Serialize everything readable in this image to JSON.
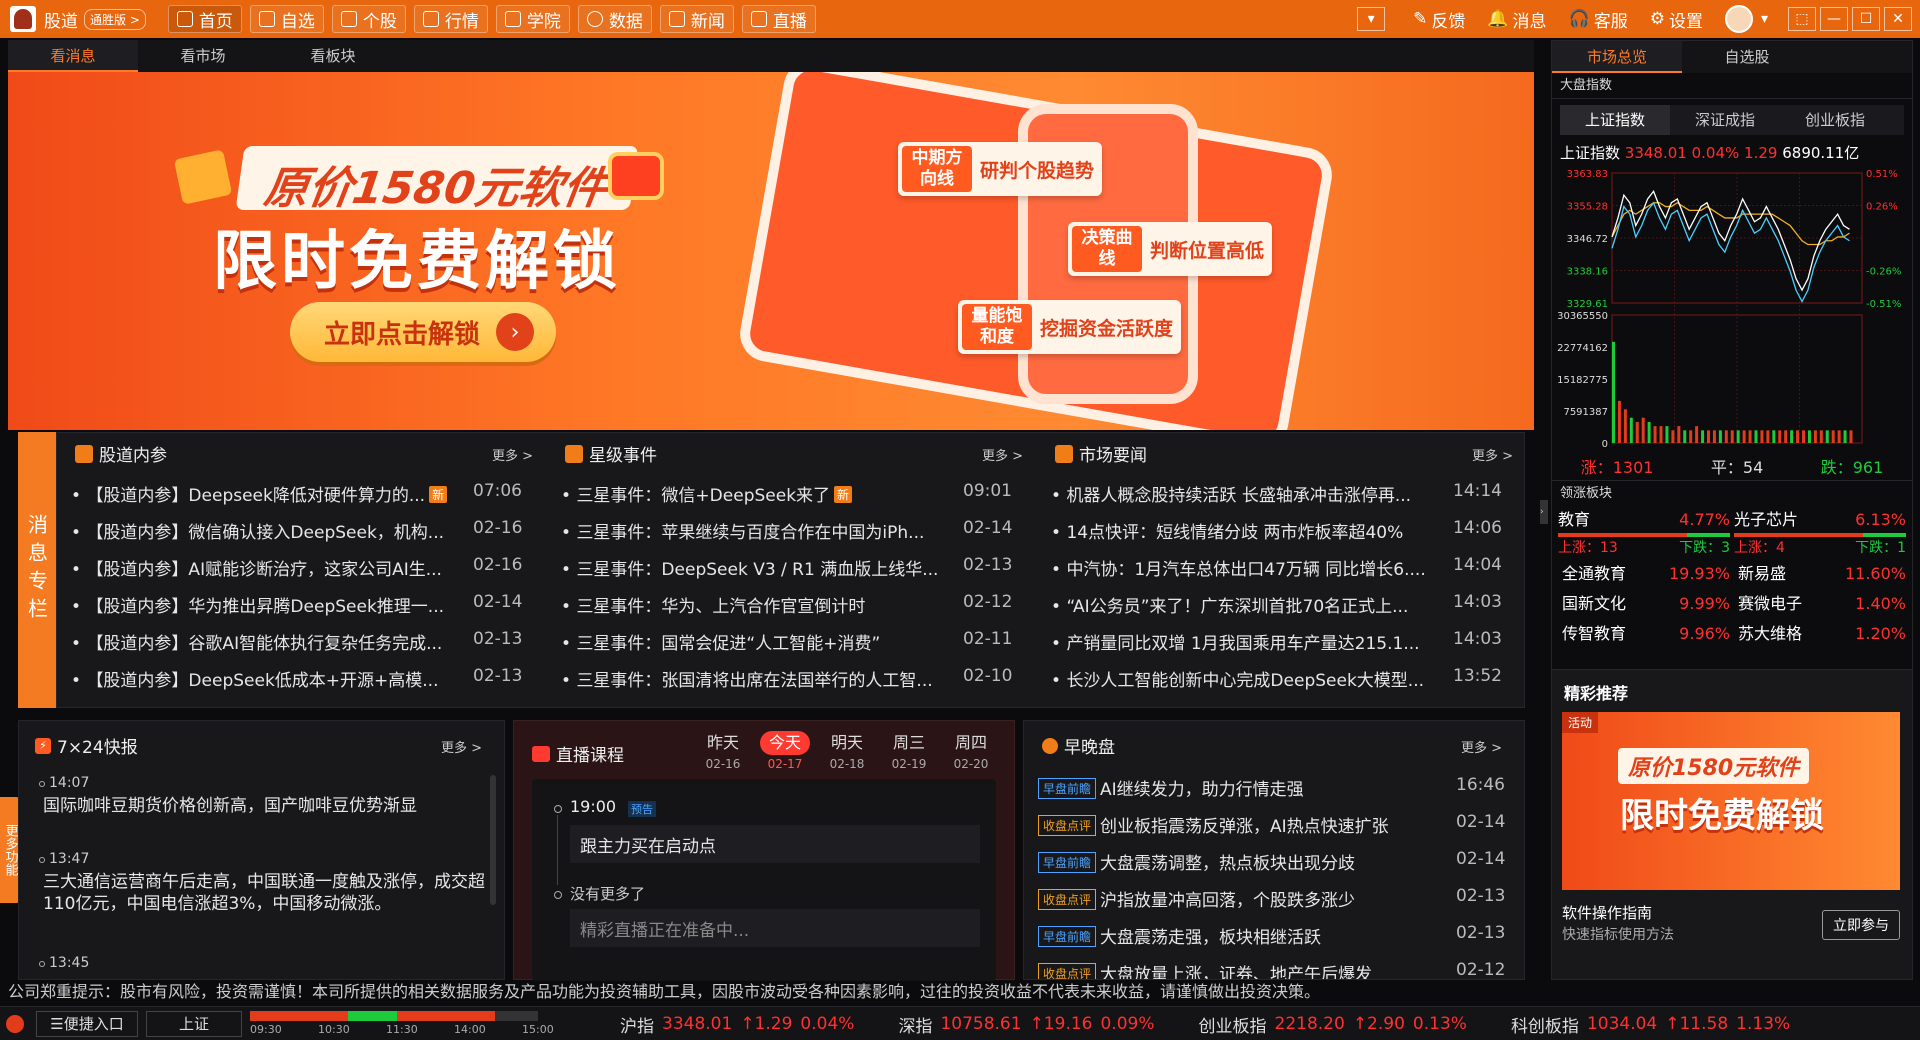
{
  "app": {
    "title": "股道",
    "edition": "通胜版 >"
  },
  "nav": [
    {
      "label": "首页",
      "icon": "home-icon"
    },
    {
      "label": "自选",
      "icon": "star-icon"
    },
    {
      "label": "个股",
      "icon": "stock-icon"
    },
    {
      "label": "行情",
      "icon": "chart-icon"
    },
    {
      "label": "学院",
      "icon": "book-icon"
    },
    {
      "label": "数据",
      "icon": "data-icon"
    },
    {
      "label": "新闻",
      "icon": "news-icon"
    },
    {
      "label": "直播",
      "icon": "live-icon"
    }
  ],
  "topright": {
    "feedback": "反馈",
    "message": "消息",
    "service": "客服",
    "settings": "设置"
  },
  "tabs": [
    "看消息",
    "看市场",
    "看板块"
  ],
  "banner": {
    "line1": "原价1580元软件",
    "line2": "限时免费解锁",
    "button": "立即点击解锁",
    "labels": [
      {
        "tag": "中期方向线",
        "text": "研判个股趋势"
      },
      {
        "tag": "决策曲线",
        "text": "判断位置高低"
      },
      {
        "tag": "量能饱和度",
        "text": "挖掘资金活跃度"
      }
    ]
  },
  "news_col": {
    "label": "消息专栏"
  },
  "insider": {
    "title": "股道内参",
    "more": "更多 >",
    "items": [
      {
        "t": "【股道内参】Deepseek降低对硬件算力的...",
        "d": "07:06",
        "new": "新"
      },
      {
        "t": "【股道内参】微信确认接入DeepSeek，机构...",
        "d": "02-16"
      },
      {
        "t": "【股道内参】AI赋能诊断治疗，这家公司AI生...",
        "d": "02-16"
      },
      {
        "t": "【股道内参】华为推出昇腾DeepSeek推理一...",
        "d": "02-14"
      },
      {
        "t": "【股道内参】谷歌AI智能体执行复杂任务完成...",
        "d": "02-13"
      },
      {
        "t": "【股道内参】DeepSeek低成本+开源+高模...",
        "d": "02-13"
      }
    ]
  },
  "events": {
    "title": "星级事件",
    "more": "更多 >",
    "items": [
      {
        "t": "三星事件：微信+DeepSeek来了",
        "d": "09:01",
        "new": "新"
      },
      {
        "t": "三星事件：苹果继续与百度合作在中国为iPh...",
        "d": "02-14"
      },
      {
        "t": "三星事件：DeepSeek V3 / R1 满血版上线华...",
        "d": "02-13"
      },
      {
        "t": "三星事件：华为、上汽合作官宣倒计时",
        "d": "02-12"
      },
      {
        "t": "三星事件：国常会促进“人工智能+消费”",
        "d": "02-11"
      },
      {
        "t": "三星事件：张国清将出席在法国举行的人工智...",
        "d": "02-10"
      }
    ]
  },
  "market_news": {
    "title": "市场要闻",
    "more": "更多 >",
    "items": [
      {
        "t": "机器人概念股持续活跃 长盛轴承冲击涨停再...",
        "d": "14:14"
      },
      {
        "t": "14点快评：短线情绪分歧 两市炸板率超40%",
        "d": "14:06"
      },
      {
        "t": "中汽协：1月汽车总体出口47万辆 同比增长6....",
        "d": "14:04"
      },
      {
        "t": "“AI公务员”来了！广东深圳首批70名正式上...",
        "d": "14:03"
      },
      {
        "t": "产销量同比双增 1月我国乘用车产量达215.1...",
        "d": "14:03"
      },
      {
        "t": "长沙人工智能创新中心完成DeepSeek大模型...",
        "d": "13:52"
      }
    ]
  },
  "flash": {
    "title": "7×24快报",
    "more": "更多 >",
    "items": [
      {
        "time": "14:07",
        "text": "国际咖啡豆期货价格创新高，国产咖啡豆优势渐显"
      },
      {
        "time": "13:47",
        "text": "三大通信运营商午后走高，中国联通一度触及涨停，成交超110亿元，中国电信涨超3%，中国移动微涨。"
      },
      {
        "time": "13:45",
        "text": ""
      }
    ]
  },
  "more_func": "更多功能",
  "live": {
    "title": "直播课程",
    "days": [
      {
        "w": "昨天",
        "d": "02-16"
      },
      {
        "w": "今天",
        "d": "02-17"
      },
      {
        "w": "明天",
        "d": "02-18"
      },
      {
        "w": "周三",
        "d": "02-19"
      },
      {
        "w": "周四",
        "d": "02-20"
      }
    ],
    "time": "19:00",
    "pre": "预告",
    "course": "跟主力买在启动点",
    "nomore": "没有更多了",
    "placeholder": "精彩直播正在准备中..."
  },
  "morning": {
    "title": "早晚盘",
    "more": "更多 >",
    "items": [
      {
        "tag": "早盘前瞻",
        "t": "AI继续发力，助力行情走强",
        "d": "16:46"
      },
      {
        "tag": "收盘点评",
        "t": "创业板指震荡反弹涨，AI热点快速扩张",
        "d": "02-14"
      },
      {
        "tag": "早盘前瞻",
        "t": "大盘震荡调整，热点板块出现分歧",
        "d": "02-14"
      },
      {
        "tag": "收盘点评",
        "t": "沪指放量冲高回落，个股跌多涨少",
        "d": "02-13"
      },
      {
        "tag": "早盘前瞻",
        "t": "大盘震荡走强，板块相继活跃",
        "d": "02-13"
      },
      {
        "tag": "收盘点评",
        "t": "大盘放量上涨，证券、地产午后爆发",
        "d": "02-12"
      }
    ]
  },
  "side_tabs": [
    "市场总览",
    "自选股"
  ],
  "index_section": "大盘指数",
  "index_tabs": [
    "上证指数",
    "深证成指",
    "创业板指"
  ],
  "sh": {
    "name": "上证指数",
    "price": "3348.01",
    "pct": "0.04%",
    "chg": "1.29",
    "amount": "6890.11亿"
  },
  "chart_data": {
    "type": "line",
    "yticks_left": [
      "3363.83",
      "3355.28",
      "3346.72",
      "3338.16",
      "3329.61"
    ],
    "yticks_right": [
      "0.51%",
      "0.26%",
      "-0.26%",
      "-0.51%"
    ],
    "vol_ticks": [
      "30365550",
      "22774162",
      "15182775",
      "7591387",
      "0"
    ],
    "price": [
      3347,
      3352,
      3358,
      3356,
      3350,
      3353,
      3357,
      3359,
      3355,
      3352,
      3356,
      3357,
      3353,
      3349,
      3352,
      3355,
      3356,
      3352,
      3348,
      3346,
      3350,
      3353,
      3357,
      3354,
      3351,
      3352,
      3355,
      3352,
      3349,
      3345,
      3341,
      3336,
      3333,
      3336,
      3342,
      3346,
      3349,
      3351,
      3353,
      3350,
      3349
    ],
    "avg": [
      3347,
      3350,
      3353,
      3354,
      3353,
      3354,
      3355,
      3356,
      3356,
      3355,
      3355,
      3356,
      3355,
      3354,
      3354,
      3354,
      3355,
      3354,
      3353,
      3352,
      3352,
      3352,
      3353,
      3353,
      3353,
      3353,
      3353,
      3353,
      3352,
      3351,
      3350,
      3348,
      3346,
      3345,
      3345,
      3345,
      3346,
      3346,
      3347,
      3347,
      3348
    ],
    "volume": [
      24,
      10,
      8,
      6,
      5,
      6,
      5,
      4,
      4,
      4,
      3,
      4,
      3,
      3,
      4,
      3,
      3,
      3,
      3,
      3,
      3,
      3,
      3,
      3,
      3,
      3,
      3,
      3,
      3,
      3,
      3,
      3,
      3,
      3,
      3,
      3,
      3,
      3,
      3,
      3,
      3
    ]
  },
  "breadth": {
    "up_label": "涨：",
    "up": "1301",
    "flat_label": "平：",
    "flat": "54",
    "down_label": "跌：",
    "down": "961"
  },
  "sectors_title": "领涨板块",
  "sectors": [
    {
      "name": "教育",
      "pct": "4.77%",
      "up": "上涨：13",
      "down": "下跌：3",
      "stocks": [
        {
          "n": "全通教育",
          "p": "19.93%"
        },
        {
          "n": "国新文化",
          "p": "9.99%"
        },
        {
          "n": "传智教育",
          "p": "9.96%"
        }
      ]
    },
    {
      "name": "光子芯片",
      "pct": "6.13%",
      "up": "上涨：4",
      "down": "下跌：1",
      "stocks": [
        {
          "n": "新易盛",
          "p": "11.60%"
        },
        {
          "n": "赛微电子",
          "p": "1.40%"
        },
        {
          "n": "苏大维格",
          "p": "1.20%"
        }
      ]
    }
  ],
  "promo": {
    "title": "精彩推荐",
    "badge": "活动",
    "line1": "原价1580元软件",
    "line2": "限时免费解锁",
    "guide_title": "软件操作指南",
    "guide_sub": "快速指标使用方法",
    "join": "立即参与"
  },
  "disclaimer": "公司郑重提示：股市有风险，投资需谨慎！本司所提供的相关数据服务及产品功能为投资辅助工具，因股市波动受各种因素影响，过往的投资收益不代表未来收益，请谨慎做出投资决策。",
  "statusbar": {
    "quick": "☰便捷入口",
    "market": "上证",
    "times": [
      "09:30",
      "10:30",
      "11:30",
      "14:00",
      "15:00"
    ],
    "progress": 0.85,
    "indices": [
      {
        "n": "沪指",
        "v": "3348.01",
        "c": "↑1.29",
        "p": "0.04%"
      },
      {
        "n": "深指",
        "v": "10758.61",
        "c": "↑19.16",
        "p": "0.09%"
      },
      {
        "n": "创业板指",
        "v": "2218.20",
        "c": "↑2.90",
        "p": "0.13%"
      },
      {
        "n": "科创板指",
        "v": "1034.04",
        "c": "↑11.58",
        "p": "1.13%"
      }
    ]
  }
}
